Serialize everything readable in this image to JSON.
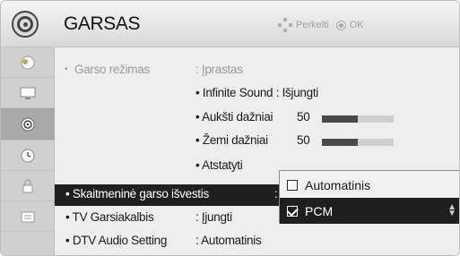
{
  "header": {
    "title": "GARSAS",
    "hint_move": "Perkelti",
    "hint_ok": "OK",
    "icon": "speaker-icon"
  },
  "sidebar": {
    "items": [
      {
        "icon": "picture-icon"
      },
      {
        "icon": "screen-icon"
      },
      {
        "icon": "speaker-icon",
        "active": true
      },
      {
        "icon": "clock-icon"
      },
      {
        "icon": "lock-icon"
      },
      {
        "icon": "options-icon"
      }
    ]
  },
  "menu": {
    "sound_mode_label": "Garso režimas",
    "sound_mode_value": ": Įprastas",
    "infinite_sound": "• Infinite Sound : Išjungti",
    "treble_label": "• Aukšti dažniai",
    "treble_value": "50",
    "treble_level": 0.5,
    "bass_label": "• Žemi dažniai",
    "bass_value": "50",
    "bass_level": 0.5,
    "reset_label": "• Atstatyti",
    "digital_out_label": "• Skaitmeninė garso išvestis",
    "digital_out_colon": ":",
    "tv_speaker_label": "• TV Garsiakalbis",
    "tv_speaker_value": ": Įjungti",
    "dtv_audio_label": "• DTV Audio Setting",
    "dtv_audio_value": ": Automatinis"
  },
  "popup": {
    "options": [
      {
        "label": "Automatinis",
        "checked": false
      },
      {
        "label": "PCM",
        "checked": true
      }
    ]
  },
  "colors": {
    "highlight": "#1f1f1f",
    "background": "#eeeeee"
  }
}
